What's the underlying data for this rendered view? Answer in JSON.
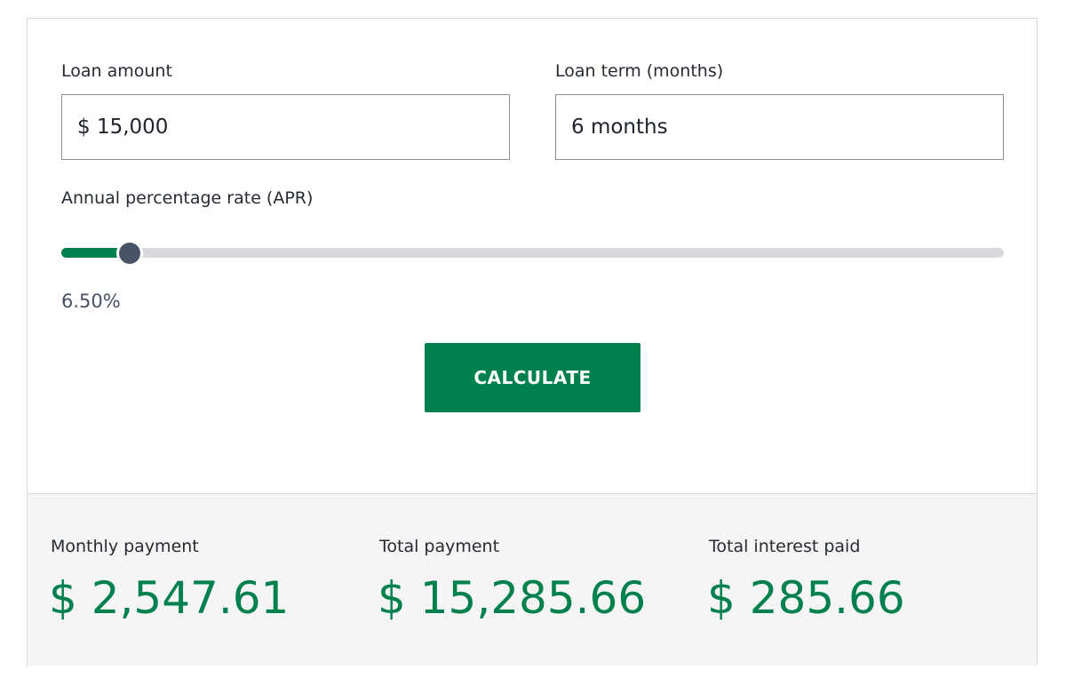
{
  "loan_amount": {
    "label": "Loan amount",
    "value": "$ 15,000"
  },
  "loan_term": {
    "label": "Loan term (months)",
    "value": "6 months"
  },
  "apr": {
    "label": "Annual percentage rate (APR)",
    "value_text": "6.50%",
    "slider_fraction": 0.073
  },
  "calculate_label": "CALCULATE",
  "results": {
    "monthly": {
      "label": "Monthly payment",
      "value": "$ 2,547.61"
    },
    "total": {
      "label": "Total payment",
      "value": "$ 15,285.66"
    },
    "interest": {
      "label": "Total interest paid",
      "value": "$ 285.66"
    }
  },
  "colors": {
    "accent": "#00804d",
    "slider_thumb": "#485366",
    "track": "#d8d9dc",
    "results_background": "#f5f5f5"
  }
}
